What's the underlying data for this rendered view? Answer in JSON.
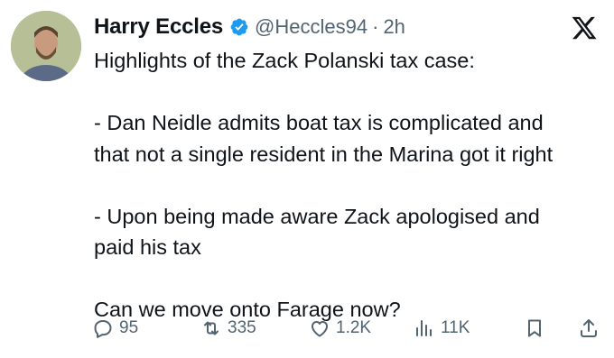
{
  "author": {
    "name": "Harry Eccles",
    "handle": "@Heccles94",
    "separator": "·",
    "time": "2h",
    "avatar_icon": "profile-photo",
    "verified_color": "#1d9bf0"
  },
  "tweet": {
    "lines": [
      "Highlights of the Zack Polanski tax case:",
      "",
      "- Dan Neidle admits boat tax is complicated and\nthat not a single resident in the Marina got it right",
      "",
      "- Upon being made aware Zack apologised and\npaid his tax",
      "",
      "Can we move onto Farage now?"
    ]
  },
  "actions": {
    "replies": "95",
    "reposts": "335",
    "likes": "1.2K",
    "views": "11K"
  },
  "colors": {
    "text": "#0f1419",
    "secondary": "#536471",
    "accent": "#1d9bf0"
  }
}
